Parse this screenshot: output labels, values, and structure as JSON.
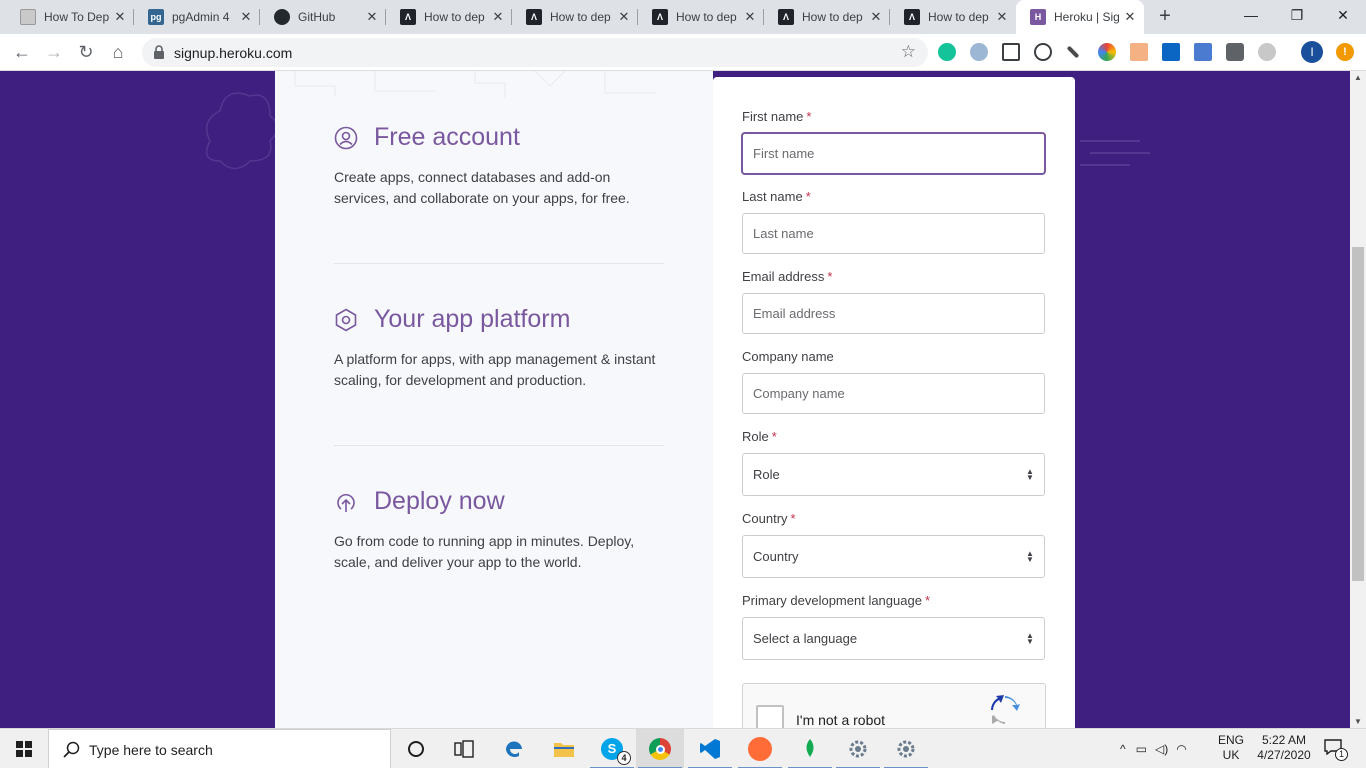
{
  "browser": {
    "tabs": [
      {
        "title": "How To Dep",
        "favicon": "doc-favicon",
        "color": "#8a8a8a"
      },
      {
        "title": "pgAdmin 4",
        "favicon": "pgadmin-favicon",
        "color": "#336791"
      },
      {
        "title": "GitHub",
        "favicon": "github-favicon",
        "color": "#24292e"
      },
      {
        "title": "How to dep",
        "favicon": "react-favicon",
        "color": "#20232a"
      },
      {
        "title": "How to dep",
        "favicon": "react-favicon",
        "color": "#20232a"
      },
      {
        "title": "How to dep",
        "favicon": "react-favicon",
        "color": "#20232a"
      },
      {
        "title": "How to dep",
        "favicon": "react-favicon",
        "color": "#20232a"
      },
      {
        "title": "How to dep",
        "favicon": "react-favicon",
        "color": "#20232a"
      },
      {
        "title": "Heroku | Sig",
        "favicon": "heroku-favicon",
        "color": "#79589f",
        "active": true
      }
    ],
    "url": "signup.heroku.com"
  },
  "page": {
    "features": [
      {
        "title": "Free account",
        "description": "Create apps, connect databases and add-on services, and collaborate on your apps, for free.",
        "icon": "user-circle-icon"
      },
      {
        "title": "Your app platform",
        "description": "A platform for apps, with app management & instant scaling, for development and production.",
        "icon": "hexagon-icon"
      },
      {
        "title": "Deploy now",
        "description": "Go from code to running app in minutes. Deploy, scale, and deliver your app to the world.",
        "icon": "upload-arrow-icon"
      }
    ],
    "form": {
      "first_name": {
        "label": "First name",
        "required": "*",
        "placeholder": "First name"
      },
      "last_name": {
        "label": "Last name",
        "required": "*",
        "placeholder": "Last name"
      },
      "email": {
        "label": "Email address",
        "required": "*",
        "placeholder": "Email address"
      },
      "company": {
        "label": "Company name",
        "placeholder": "Company name"
      },
      "role": {
        "label": "Role",
        "required": "*",
        "value": "Role"
      },
      "country": {
        "label": "Country",
        "required": "*",
        "value": "Country"
      },
      "language": {
        "label": "Primary development language",
        "required": "*",
        "value": "Select a language"
      },
      "captcha": {
        "label": "I'm not a robot"
      }
    }
  },
  "taskbar": {
    "search_placeholder": "Type here to search",
    "language": "ENG",
    "region": "UK",
    "time": "5:22 AM",
    "date": "4/27/2020",
    "skype_badge": "4",
    "notification_count": "1"
  },
  "colors": {
    "heroku_purple": "#79589f",
    "page_background": "#3f1f80",
    "required_marker": "#c6304a"
  }
}
